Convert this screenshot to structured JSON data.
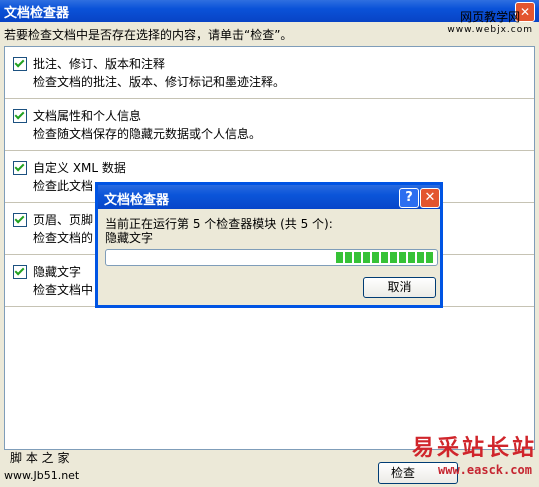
{
  "main_window": {
    "title": "文档检查器",
    "instruction": "若要检查文档中是否存在选择的内容，请单击“检查”。",
    "bottom_button": "检查"
  },
  "items": [
    {
      "title": "批注、修订、版本和注释",
      "desc": "检查文档的批注、版本、修订标记和墨迹注释。",
      "checked": true
    },
    {
      "title": "文档属性和个人信息",
      "desc": "检查随文档保存的隐藏元数据或个人信息。",
      "checked": true
    },
    {
      "title": "自定义 XML 数据",
      "desc": "检查此文档",
      "checked": true
    },
    {
      "title": "页眉、页脚",
      "desc": "检查文档的",
      "checked": true
    },
    {
      "title": "隐藏文字",
      "desc": "检查文档中",
      "checked": true
    }
  ],
  "dialog": {
    "title": "文档检查器",
    "status": "当前正在运行第 5 个检查器模块 (共 5 个):",
    "current_module": "隐藏文字",
    "progress_fraction": 0.3,
    "cancel_label": "取消",
    "help_label": "?",
    "close_label": "✕"
  },
  "watermarks": {
    "top_right_title": "网页教学网",
    "top_right_url": "www.webjx.com",
    "bottom_left_title": "脚 本 之 家",
    "bottom_left_url": "www.Jb51.net",
    "bottom_right_title": "易采站长站",
    "bottom_right_url": "www.easck.com"
  },
  "colors": {
    "titlebar": "#0a52d8",
    "progress": "#36c236",
    "watermark_red": "#d0252b"
  }
}
